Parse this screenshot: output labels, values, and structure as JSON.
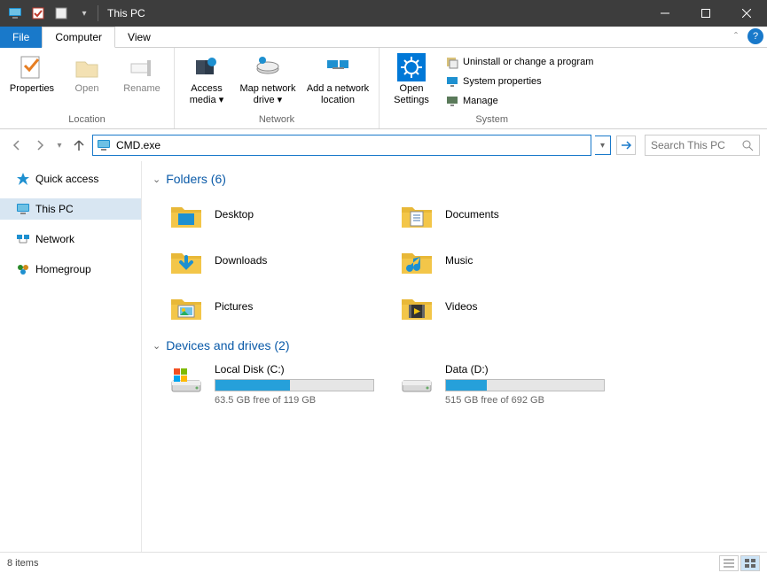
{
  "window": {
    "title": "This PC"
  },
  "menu": {
    "file": "File",
    "tabs": [
      "Computer",
      "View"
    ]
  },
  "ribbon": {
    "groups": {
      "location": {
        "label": "Location",
        "properties": "Properties",
        "open": "Open",
        "rename": "Rename"
      },
      "network": {
        "label": "Network",
        "access_media": "Access media",
        "map_drive": "Map network drive",
        "add_location": "Add a network location"
      },
      "system": {
        "label": "System",
        "open_settings": "Open Settings",
        "uninstall": "Uninstall or change a program",
        "sys_props": "System properties",
        "manage": "Manage"
      }
    }
  },
  "nav": {
    "address": "CMD.exe",
    "search_placeholder": "Search This PC"
  },
  "sidebar": {
    "items": [
      {
        "label": "Quick access"
      },
      {
        "label": "This PC"
      },
      {
        "label": "Network"
      },
      {
        "label": "Homegroup"
      }
    ]
  },
  "sections": {
    "folders_header": "Folders (6)",
    "drives_header": "Devices and drives (2)"
  },
  "folders": [
    {
      "name": "Desktop"
    },
    {
      "name": "Documents"
    },
    {
      "name": "Downloads"
    },
    {
      "name": "Music"
    },
    {
      "name": "Pictures"
    },
    {
      "name": "Videos"
    }
  ],
  "drives": [
    {
      "name": "Local Disk (C:)",
      "free": "63.5 GB free of 119 GB",
      "fill_pct": 47
    },
    {
      "name": "Data (D:)",
      "free": "515 GB free of 692 GB",
      "fill_pct": 26
    }
  ],
  "statusbar": {
    "items": "8 items"
  }
}
